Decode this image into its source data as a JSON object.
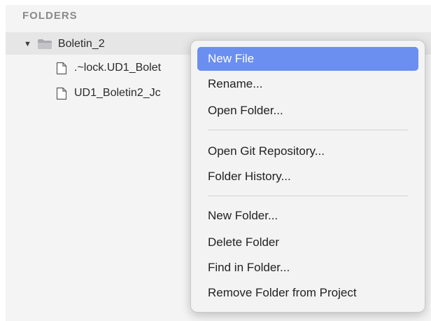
{
  "sidebar": {
    "section_title": "FOLDERS",
    "folder": {
      "name": "Boletin_2",
      "expanded": true,
      "icon": "folder-icon",
      "disclosure_icon": "triangle-down-icon",
      "files": [
        {
          "name": ".~lock.UD1_Bolet",
          "icon": "file-icon"
        },
        {
          "name": "UD1_Boletin2_Jc",
          "icon": "file-icon"
        }
      ]
    }
  },
  "context_menu": {
    "highlight_color": "#6a8ff0",
    "groups": [
      [
        "New File",
        "Rename...",
        "Open Folder..."
      ],
      [
        "Open Git Repository...",
        "Folder History..."
      ],
      [
        "New Folder...",
        "Delete Folder",
        "Find in Folder...",
        "Remove Folder from Project"
      ]
    ],
    "active_item": "New File"
  }
}
